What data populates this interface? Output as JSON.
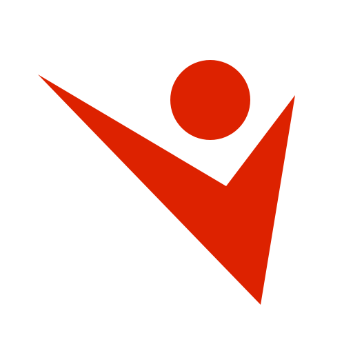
{
  "icon": {
    "name": "person-checkmark-logo-icon",
    "background_color": "#ffffff",
    "mark_color": "#dd2200"
  }
}
